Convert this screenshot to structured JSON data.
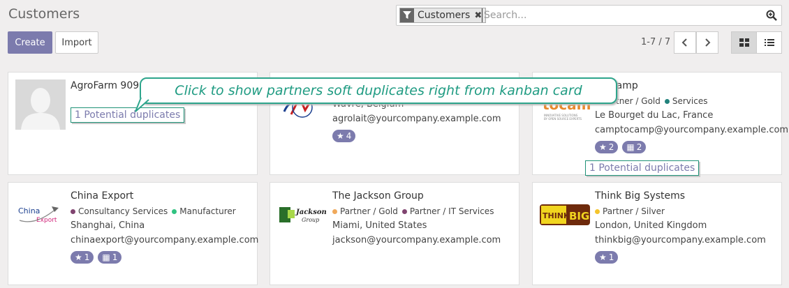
{
  "page": {
    "title": "Customers"
  },
  "toolbar": {
    "create_label": "Create",
    "import_label": "Import"
  },
  "search": {
    "facet_label": "Customers",
    "placeholder": "Search..."
  },
  "pager": {
    "range": "1-7 / 7"
  },
  "callout": {
    "text": "Click to show partners soft duplicates right from kanban card"
  },
  "colors": {
    "accent": "#7c7bad",
    "callout": "#2ea58c"
  },
  "cards": [
    {
      "name": "AgroFarm 909",
      "duplicates": "1 Potential duplicates",
      "image": "avatar-placeholder"
    },
    {
      "name": "",
      "tags": [],
      "address": "Wavre, Belgium",
      "email": "agrolait@yourcompany.example.com",
      "stars": "4",
      "image": "agrolait-logo"
    },
    {
      "name": "ptocamp",
      "tags": [
        {
          "label": "Partner / Gold",
          "color": "#f0a95b"
        },
        {
          "label": "Services",
          "color": "#21827c"
        }
      ],
      "address": "Le Bourget du Lac, France",
      "email": "camptocamp@yourcompany.example.com",
      "stars": "2",
      "activities": "2",
      "duplicates": "1 Potential duplicates",
      "image": "camptocamp-logo"
    },
    {
      "name": "China Export",
      "tags": [
        {
          "label": "Consultancy Services",
          "color": "#804470"
        },
        {
          "label": "Manufacturer",
          "color": "#30c381"
        }
      ],
      "address": "Shanghai, China",
      "email": "chinaexport@yourcompany.example.com",
      "stars": "1",
      "activities": "1",
      "image": "china-export-logo"
    },
    {
      "name": "The Jackson Group",
      "tags": [
        {
          "label": "Partner / Gold",
          "color": "#f0a95b"
        },
        {
          "label": "Partner / IT Services",
          "color": "#804470"
        }
      ],
      "address": "Miami, United States",
      "email": "jackson@yourcompany.example.com",
      "image": "jackson-group-logo"
    },
    {
      "name": "Think Big Systems",
      "tags": [
        {
          "label": "Partner / Silver",
          "color": "#f4c42c"
        }
      ],
      "address": "London, United Kingdom",
      "email": "thinkbig@yourcompany.example.com",
      "stars": "1",
      "image": "think-big-logo"
    }
  ]
}
